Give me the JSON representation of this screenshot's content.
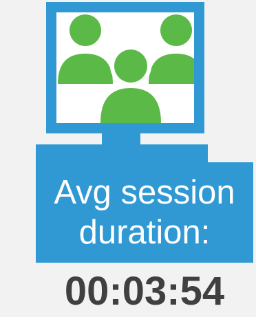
{
  "card": {
    "icon": "video-conference-monitor-icon",
    "label_line1": "Avg session",
    "label_line2": "duration:",
    "value": "00:03:54"
  },
  "colors": {
    "background": "#f2f2f2",
    "monitor_blue": "#3099d3",
    "people_green": "#5bb947",
    "value_text": "#404040",
    "label_text": "#ffffff"
  }
}
